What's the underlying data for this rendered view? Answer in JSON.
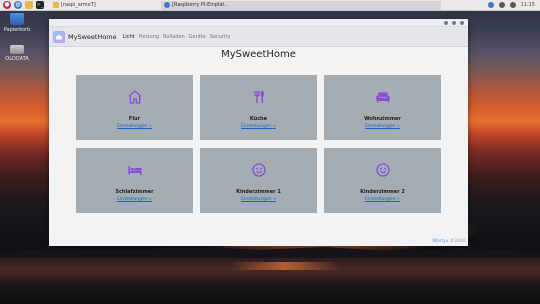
{
  "taskbar": {
    "tasks": [
      {
        "label": "[raspi_armv7]"
      },
      {
        "label": "[Raspberry Pi-Einplat..."
      }
    ],
    "clock": "11:15"
  },
  "desktop": {
    "icons": [
      {
        "label": "Papierkorb"
      },
      {
        "label": "OLDDATA"
      }
    ]
  },
  "app": {
    "brand": "MySweetHome",
    "nav": [
      {
        "label": "Licht"
      },
      {
        "label": "Heizung"
      },
      {
        "label": "Rolladen"
      },
      {
        "label": "Geräte"
      },
      {
        "label": "Security"
      }
    ],
    "page_title": "MySweetHome",
    "rooms": [
      {
        "name": "Flur",
        "link": "Einstellungen »",
        "icon": "home-icon"
      },
      {
        "name": "Küche",
        "link": "Einstellungen »",
        "icon": "cutlery-icon"
      },
      {
        "name": "Wohnzimmer",
        "link": "Einstellungen »",
        "icon": "sofa-icon"
      },
      {
        "name": "Schlafzimmer",
        "link": "Einstellungen »",
        "icon": "bed-icon"
      },
      {
        "name": "Kinderzimmer 1",
        "link": "Einstellungen »",
        "icon": "smiley-icon"
      },
      {
        "name": "Kinderzimmer 2",
        "link": "Einstellungen »",
        "icon": "smiley-icon"
      }
    ],
    "footer": {
      "link": "Mbstyx",
      "text": "©2020"
    },
    "accent_color": "#8a4fd8",
    "tile_color": "#a5adb3"
  }
}
